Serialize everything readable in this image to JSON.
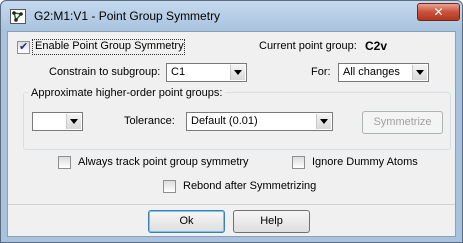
{
  "window": {
    "title": "G2:M1:V1 - Point Group Symmetry",
    "close_glyph": "✕"
  },
  "enable_checkbox": {
    "label": "Enable Point Group Symmetry",
    "checked": true
  },
  "current_point_group": {
    "label": "Current point group:",
    "value": "C2v"
  },
  "constrain": {
    "label": "Constrain to subgroup:",
    "value": "C1"
  },
  "for": {
    "label": "For:",
    "value": "All changes"
  },
  "approx_group": {
    "legend": "Approximate higher-order point groups:",
    "group_value": "",
    "tolerance_label": "Tolerance:",
    "tolerance_value": "Default (0.01)",
    "symmetrize_label": "Symmetrize"
  },
  "options": {
    "always_track": {
      "label": "Always track point group symmetry",
      "checked": false
    },
    "ignore_dummy": {
      "label": "Ignore Dummy Atoms",
      "checked": false
    },
    "rebond": {
      "label": "Rebond after Symmetrizing",
      "checked": false
    }
  },
  "buttons": {
    "ok": "Ok",
    "help": "Help"
  },
  "colors": {
    "titlebar": "#a9c3de",
    "close": "#c9523a",
    "client": "#f0f0f0"
  },
  "icons": {
    "app": "molecule-icon",
    "close": "close-icon",
    "dropdown": "chevron-down-icon",
    "check": "checkmark-icon"
  }
}
